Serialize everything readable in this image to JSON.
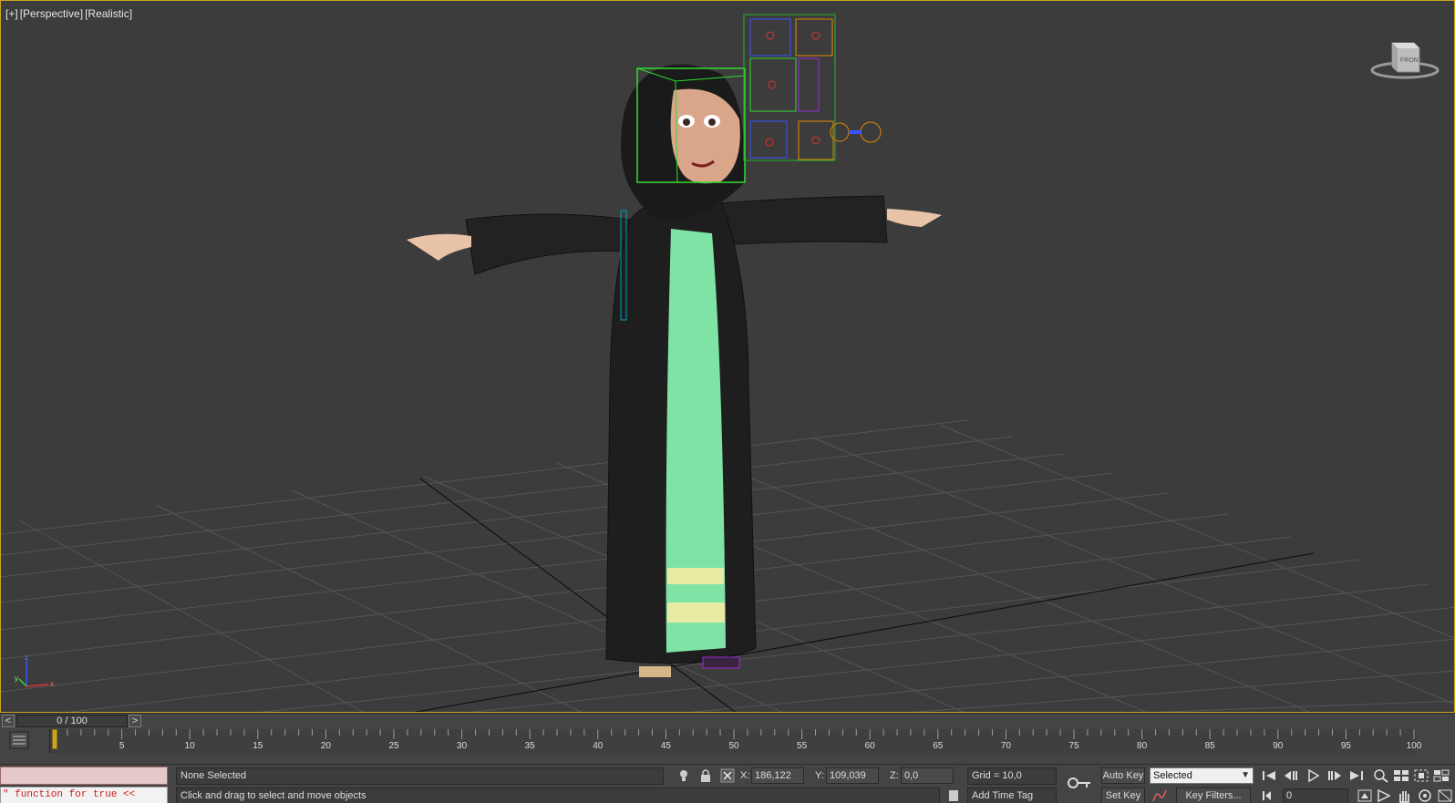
{
  "viewport": {
    "labels": [
      "[+]",
      "[Perspective]",
      "[Realistic]"
    ],
    "viewcube_face": "FRONT",
    "axis_labels": [
      "z",
      "x",
      "y"
    ]
  },
  "timeslider": {
    "prev": "<",
    "next": ">",
    "position": "0 / 100"
  },
  "trackbar": {
    "ticks": [
      "5",
      "10",
      "15",
      "20",
      "25",
      "30",
      "35",
      "40",
      "45",
      "50",
      "55",
      "60",
      "65",
      "70",
      "75",
      "80",
      "85",
      "90",
      "95",
      "100"
    ]
  },
  "statusbar": {
    "maxscript_output": "\" function for true <<",
    "selection_status": "None Selected",
    "prompt": "Click and drag to select and move objects",
    "x_label": "X:",
    "x_value": "186,122",
    "y_label": "Y:",
    "y_value": "109,039",
    "z_label": "Z:",
    "z_value": "0,0",
    "grid": "Grid = 10,0",
    "add_time_tag": "Add Time Tag",
    "auto_key": "Auto Key",
    "set_key": "Set Key",
    "key_mode": "Selected",
    "key_filters": "Key Filters...",
    "current_frame": "0"
  },
  "colors": {
    "viewport_bg": "#3c3c3c",
    "active_border": "#c8a623",
    "ui_bg": "#444444",
    "robe_green": "#7fe3a6",
    "robe_black": "#1e1e1e"
  }
}
